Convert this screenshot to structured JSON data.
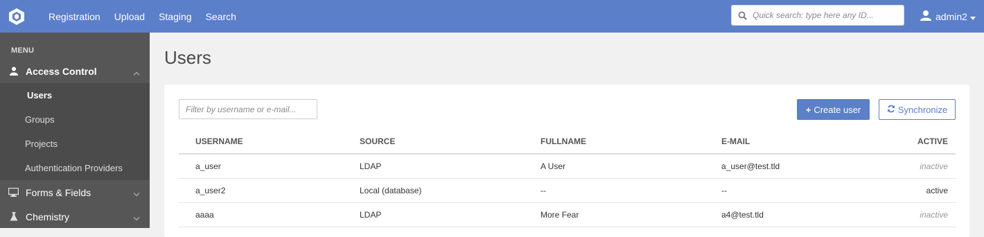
{
  "nav": {
    "items": [
      "Registration",
      "Upload",
      "Staging",
      "Search"
    ]
  },
  "quick_search": {
    "placeholder": "Quick search: type here any ID..."
  },
  "user": {
    "name": "admin2"
  },
  "sidebar": {
    "menu_label": "MENU",
    "access_control": "Access Control",
    "sub_items": [
      "Users",
      "Groups",
      "Projects",
      "Authentication Providers"
    ],
    "forms_fields": "Forms & Fields",
    "chemistry": "Chemistry"
  },
  "page": {
    "title": "Users"
  },
  "toolbar": {
    "filter_placeholder": "Filter by username or e-mail...",
    "create_label": "Create user",
    "sync_label": "Synchronize"
  },
  "table": {
    "headers": [
      "USERNAME",
      "SOURCE",
      "FULLNAME",
      "E-MAIL",
      "ACTIVE"
    ],
    "rows": [
      {
        "username": "a_user",
        "source": "LDAP",
        "fullname": "A User",
        "email": "a_user@test.tld",
        "active": "inactive"
      },
      {
        "username": "a_user2",
        "source": "Local (database)",
        "fullname": "--",
        "email": "--",
        "active": "active"
      },
      {
        "username": "aaaa",
        "source": "LDAP",
        "fullname": "More Fear",
        "email": "a4@test.tld",
        "active": "inactive"
      }
    ]
  },
  "colors": {
    "accent": "#5b7fc9",
    "sidebar": "#565656",
    "sidebar_sub": "#4b4b4b"
  }
}
